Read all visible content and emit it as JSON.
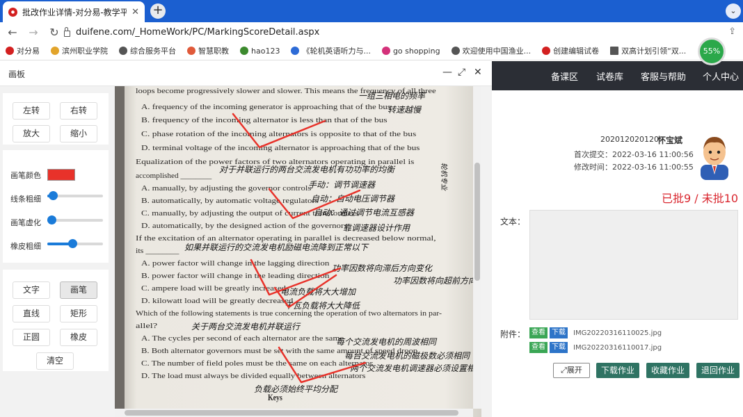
{
  "browser": {
    "tab_title": "批改作业详情-对分易-教学平台",
    "tab_close": "✕",
    "new_tab": "+",
    "tab_menu": "⌄",
    "back": "←",
    "forward": "→",
    "reload": "↻",
    "url": "duifene.com/_HomeWork/PC/MarkingScoreDetail.aspx",
    "share": "⇪",
    "bookmarks": [
      {
        "label": "对分易",
        "color": "#d32020"
      },
      {
        "label": "滨州职业学院",
        "color": "#e2a42b"
      },
      {
        "label": "综合服务平台",
        "color": "#555555"
      },
      {
        "label": "智慧职教",
        "color": "#e05a3a"
      },
      {
        "label": "hao123",
        "color": "#3c8a2e"
      },
      {
        "label": "《轮机英语听力与...",
        "color": "#2d6bd6"
      },
      {
        "label": "go shopping",
        "color": "#d4317a"
      },
      {
        "label": "欢迎使用中国渔业...",
        "color": "#555555"
      },
      {
        "label": "创建编辑试卷",
        "color": "#d32020"
      },
      {
        "label": "双高计划引领“双...",
        "color": "#555555"
      }
    ],
    "progress_value": 0.55,
    "progress_text": "55%"
  },
  "board": {
    "title": "画板",
    "minimize": "—",
    "maximize": "⤢",
    "close": "✕",
    "buttons_top": {
      "rotate_left": "左转",
      "rotate_right": "右转",
      "zoom_in": "放大",
      "zoom_out": "缩小"
    },
    "pen_color_label": "画笔颜色",
    "pen_color": "#e8322a",
    "line_width_label": "线条粗细",
    "line_width_value": 0.1,
    "pen_blur_label": "画笔虚化",
    "pen_blur_value": 0.0,
    "eraser_width_label": "橡皮粗细",
    "eraser_width_value": 0.45,
    "tools": {
      "text": "文字",
      "pen": "画笔",
      "line": "直线",
      "rect": "矩形",
      "circle": "正圆",
      "eraser": "橡皮",
      "clear": "清空"
    },
    "active_tool": "pen",
    "doc_lines": [
      "loops become progressively slower and slower. This means the frequency of all three",
      "A. frequency of the incoming generator is approaching that of the bus",
      "B. frequency of the incoming alternator is less than that of the bus",
      "C. phase rotation of the incoming alternators is opposite to that of the bus",
      "D. terminal voltage of the incoming alternator is approaching that of the bus",
      "Equalization of the power factors of two alternators operating in parallel is",
      "accomplished ________",
      "A. manually, by adjusting the governor controls",
      "B. automatically, by automatic voltage regulators",
      "C. manually, by adjusting the output of current transformers",
      "D. automatically, by the designed action of the governors",
      "If the excitation of an alternator operating in parallel is decreased below normal,",
      "its ________",
      "A. power factor will change in the lagging direction",
      "B. power factor will change in the leading direction",
      "C. ampere load will be greatly increased",
      "D. kilowatt load will be greatly decreased",
      "Which of the following statements is true concerning the operation of two alternators in par-",
      "allel?",
      "A. The cycles per second of each alternator are the same",
      "B. Both alternator governors must be set with the same amount of speed droop.",
      "C. The number of field poles must be the same on each alternator",
      "D. The load must always be divided equally between alternators",
      "Keys"
    ],
    "handwriting": [
      "一组三相电的频率",
      "转速越慢",
      "对于并联运行的两台交流发电机有功功率的均衡",
      "手动：调节调速器",
      "自动：自动电压调节器",
      "自动：通过调节电流互感器",
      "靠调速器设计作用",
      "如果并联运行的交流发电机励磁电流降到正常以下",
      "功率因数将向滞后方向变化",
      "功率因数将向超前方向变化",
      "电流负载将大大增加",
      "千瓦负载将大大降低",
      "关于两台交流发电机并联运行",
      "每个交流发电机的周波相同",
      "两个交流发电机调速器必须设置相同的速降",
      "每台交流发电机的磁极数必须相同",
      "负载必须始终平均分配",
      "轮机专业"
    ]
  },
  "site": {
    "nav": [
      "备课区",
      "试卷库",
      "客服与帮助",
      "个人中心"
    ],
    "student_id": "202012020120",
    "student_name": "怀宝斌",
    "submit_label": "首次提交：",
    "submit_time": "2022-03-16 11:00:56",
    "modify_label": "修改时间：",
    "modify_time": "2022-03-16 11:00:55",
    "grade_status": "已批9 / 未批10",
    "text_label": "文本：",
    "attachment_label": "附件：",
    "attachments": [
      {
        "view": "查看",
        "download": "下载",
        "name": "IMG20220316110025.jpg"
      },
      {
        "view": "查看",
        "download": "下载",
        "name": "IMG20220316110017.jpg"
      }
    ],
    "expand_icon": "⤢",
    "expand": "展开",
    "download_hw": "下载作业",
    "collect_hw": "收藏作业",
    "return_hw": "退回作业"
  }
}
